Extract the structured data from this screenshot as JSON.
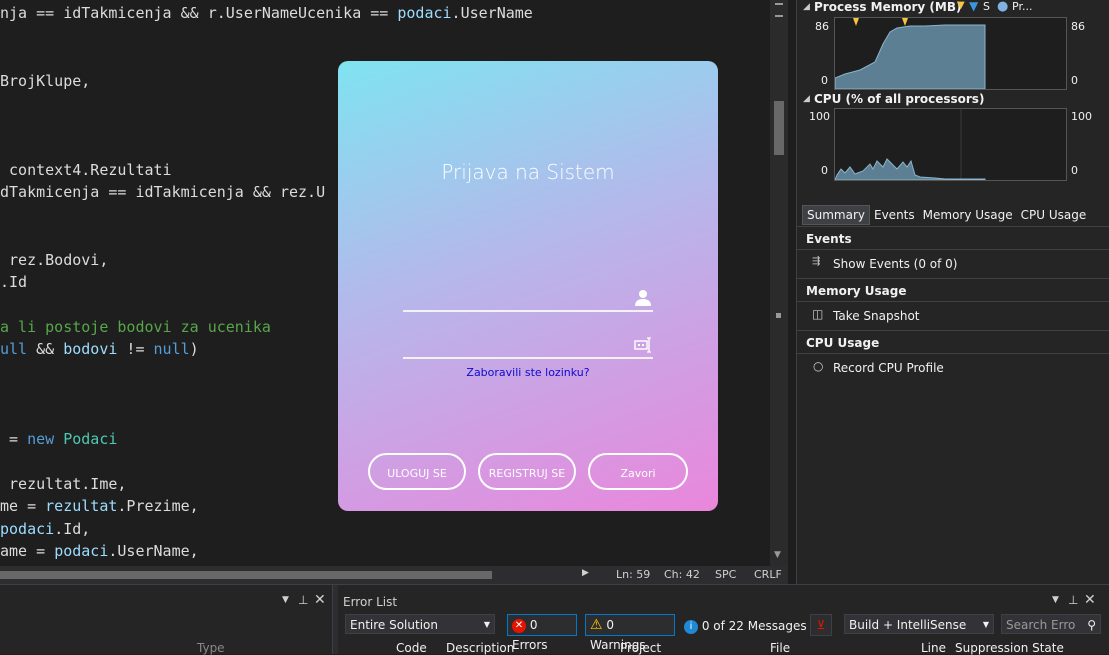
{
  "editor": {
    "lines": [
      {
        "parts": [
          {
            "t": "nja == idTakmicenja && r.UserNameUcenika == ",
            "c": "pl"
          },
          {
            "t": "podaci",
            "c": "id"
          },
          {
            "t": ".UserName",
            "c": "pl"
          }
        ]
      },
      {
        "parts": [
          {
            "t": "BrojKlupe,",
            "c": "pl"
          }
        ]
      },
      {
        "parts": [
          {
            "t": " context4.Rezultati",
            "c": "pl"
          }
        ]
      },
      {
        "parts": [
          {
            "t": "dTakmicenja == idTakmicenja && rez.U",
            "c": "pl"
          }
        ]
      },
      {
        "parts": [
          {
            "t": " rez.Bodovi,",
            "c": "pl"
          }
        ]
      },
      {
        "parts": [
          {
            "t": ".Id",
            "c": "pl"
          }
        ]
      },
      {
        "parts": [
          {
            "t": "a li postoje bodovi za ucenika",
            "c": "cm"
          }
        ]
      },
      {
        "parts": [
          {
            "t": "ull",
            "c": "kw"
          },
          {
            "t": " && ",
            "c": "pl"
          },
          {
            "t": "bodovi",
            "c": "id"
          },
          {
            "t": " != ",
            "c": "pl"
          },
          {
            "t": "null",
            "c": "kw"
          },
          {
            "t": ")",
            "c": "pl"
          }
        ]
      },
      {
        "parts": [
          {
            "t": " = ",
            "c": "pl"
          },
          {
            "t": "new",
            "c": "kw"
          },
          {
            "t": " ",
            "c": "pl"
          },
          {
            "t": "Podaci",
            "c": "ty"
          }
        ]
      },
      {
        "parts": [
          {
            "t": " rezultat.Ime,",
            "c": "pl"
          }
        ]
      },
      {
        "parts": [
          {
            "t": "me = ",
            "c": "pl"
          },
          {
            "t": "rezultat",
            "c": "id"
          },
          {
            "t": ".Prezime,",
            "c": "pl"
          }
        ]
      },
      {
        "parts": [
          {
            "t": "podaci",
            "c": "id"
          },
          {
            "t": ".Id,",
            "c": "pl"
          }
        ]
      },
      {
        "parts": [
          {
            "t": "ame = ",
            "c": "pl"
          },
          {
            "t": "podaci",
            "c": "id"
          },
          {
            "t": ".UserName,",
            "c": "pl"
          }
        ]
      }
    ]
  },
  "status": {
    "ln": "Ln: 59",
    "ch": "Ch: 42",
    "spc": "SPC",
    "crlf": "CRLF"
  },
  "diagnostics": {
    "memory_title": "Process Memory (MB)",
    "memory_legend_s": "S",
    "memory_legend_p": "Pr...",
    "memory_max": "86",
    "memory_min": "0",
    "cpu_title": "CPU (% of all processors)",
    "cpu_max": "100",
    "cpu_min": "0",
    "tabs": [
      "Summary",
      "Events",
      "Memory Usage",
      "CPU Usage"
    ],
    "events_head": "Events",
    "events_row": "Show Events (0 of 0)",
    "memory_head": "Memory Usage",
    "memory_row": "Take Snapshot",
    "cpu_head": "CPU Usage",
    "cpu_row": "Record CPU Profile"
  },
  "bottom": {
    "left_col": "Type",
    "error_list_title": "Error List",
    "scope": "Entire Solution",
    "errors": "0 Errors",
    "warnings": "0 Warnings",
    "messages": "0 of 22 Messages",
    "build": "Build + IntelliSense",
    "search_placeholder": "Search Erro",
    "cols": [
      "Code",
      "Description",
      "Project",
      "File",
      "Line",
      "Suppression State"
    ]
  },
  "login": {
    "title": "Prijava na Sistem",
    "forgot": "Zaboravili ste lozinku?",
    "btn_login": "ULOGUJ SE",
    "btn_register": "REGISTRUJ SE",
    "btn_close": "Zavori"
  }
}
